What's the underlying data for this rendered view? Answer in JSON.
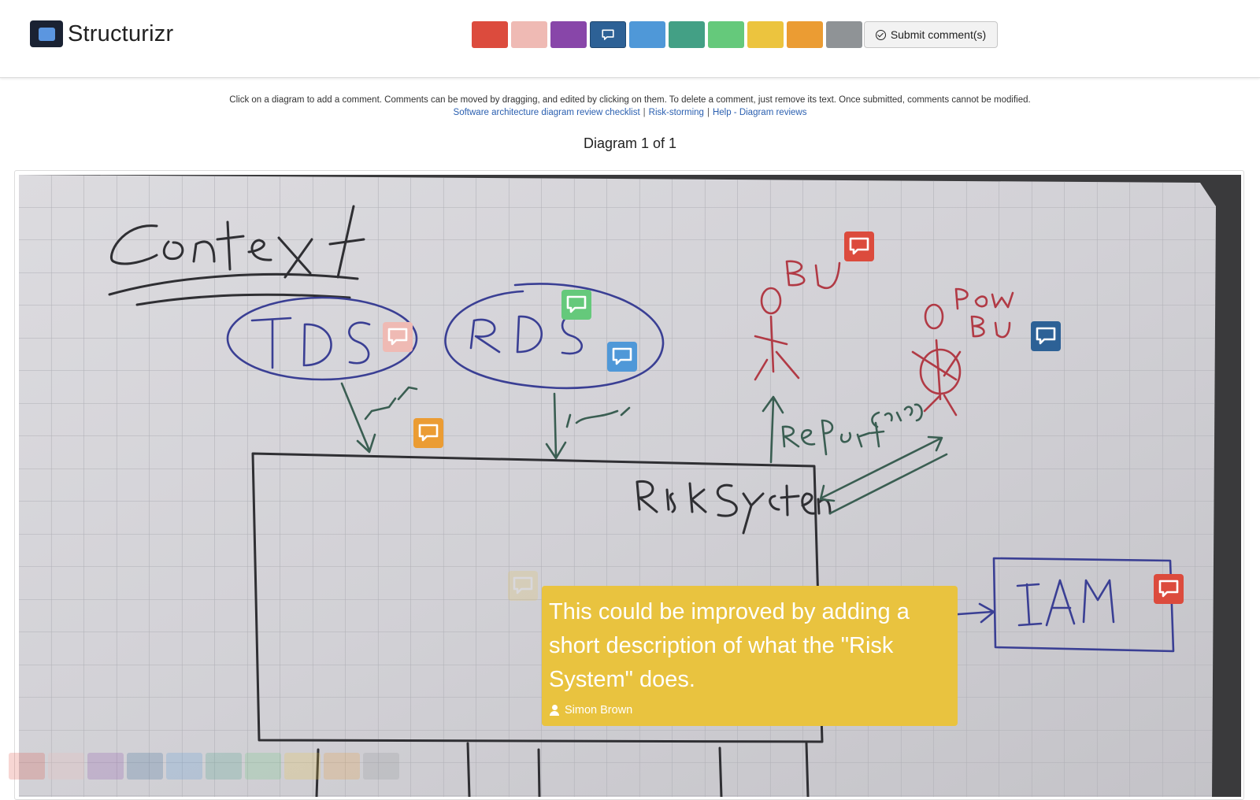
{
  "brand": {
    "name": "Structurizr"
  },
  "palette": [
    {
      "color": "#dc4b3d",
      "name": "red"
    },
    {
      "color": "#efbab4",
      "name": "pink"
    },
    {
      "color": "#8846a9",
      "name": "purple"
    },
    {
      "color": "#2d6196",
      "name": "dark-blue",
      "selected": true
    },
    {
      "color": "#4f98d8",
      "name": "blue"
    },
    {
      "color": "#43a085",
      "name": "teal"
    },
    {
      "color": "#65c97b",
      "name": "green"
    },
    {
      "color": "#ecc43e",
      "name": "yellow"
    },
    {
      "color": "#eb9c33",
      "name": "orange"
    },
    {
      "color": "#8f9396",
      "name": "gray"
    }
  ],
  "toolbar": {
    "submit_label": "Submit comment(s)"
  },
  "instructions": {
    "text": "Click on a diagram to add a comment. Comments can be moved by dragging, and edited by clicking on them. To delete a comment, just remove its text. Once submitted, comments cannot be modified.",
    "links": [
      "Software architecture diagram review checklist",
      "Risk-storming",
      "Help - Diagram reviews"
    ]
  },
  "diagram_counter": "Diagram 1 of 1",
  "diagram": {
    "sketch_labels": [
      "Context",
      "TDS",
      "RDS",
      "Input",
      "Input",
      "BU",
      "Power BU",
      "Report",
      "config",
      "Risk System",
      "IAM"
    ]
  },
  "comment_popup": {
    "text": "This could be improved by adding a short description of what the \"Risk System\" does.",
    "author": "Simon Brown"
  },
  "icons": {
    "pin": "speech-bubble-icon",
    "submit": "check-circle-icon",
    "author": "user-icon",
    "logo": "structurizr-logo-icon"
  }
}
